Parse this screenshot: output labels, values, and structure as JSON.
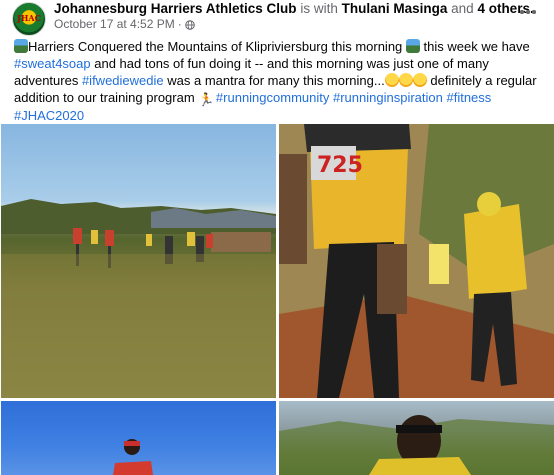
{
  "header": {
    "page_name": "Johannesburg Harriers Athletics Club",
    "is_with_text": "is with",
    "tagged_person": "Thulani Masinga",
    "and_text": "and",
    "others_link": "4 others.",
    "timestamp": "October 17 at 4:52 PM",
    "separator": "·",
    "avatar_text": "JHAC"
  },
  "post": {
    "line1_a": "Harriers Conquered the Mountains of Klipriviersburg this morning",
    "line1_b": "this week we have",
    "tag_sweat4soap": "#sweat4soap",
    "line2_a": "and had tons of fun doing it -- and this morning was just one of many",
    "line3_a": "adventures",
    "tag_ifwediewedie": "#ifwediewedie",
    "line3_b": "was a mantra for many this morning...",
    "line3_c": "definitely a regular",
    "line4_a": "addition to our training program",
    "tag_runningcommunity": "#runningcommunity",
    "tag_runninginspiration": "#runninginspiration",
    "tag_fitness": "#fitness",
    "tag_jhac2020": "#JHAC2020"
  },
  "icons": {
    "globe": "globe-icon",
    "more": "more-options-icon",
    "mountain": "mountain-emoji",
    "laugh": "laughing-emoji",
    "runner": "runner-emoji"
  },
  "colors": {
    "link": "#216fdb",
    "muted": "#65676b",
    "text": "#050505"
  }
}
